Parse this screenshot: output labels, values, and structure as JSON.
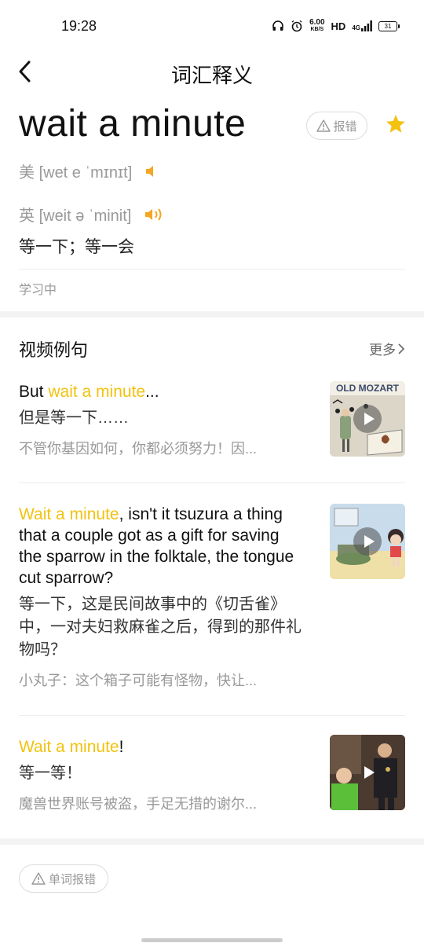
{
  "status_bar": {
    "time": "19:28",
    "net_speed_value": "6.00",
    "net_speed_unit": "KB/S",
    "hd": "HD",
    "signal": "4G",
    "battery": "31"
  },
  "header": {
    "title": "词汇释义"
  },
  "word": {
    "text": "wait a minute",
    "report_label": "报错",
    "us_label": "美",
    "us_phonetic": "[wet e ˈmɪnɪt]",
    "uk_label": "英",
    "uk_phonetic": "[weit ə ˈminit]",
    "meaning": "等一下；等一会",
    "status": "学习中"
  },
  "video_section": {
    "title": "视频例句",
    "more_label": "更多",
    "items": [
      {
        "en_pre": "But ",
        "en_hl": "wait a minute",
        "en_post": "...",
        "cn": "但是等一下……",
        "source": "不管你基因如何，你都必须努力！因...",
        "thumb_text": "OLD MOZART"
      },
      {
        "en_pre": "",
        "en_hl": "Wait a minute",
        "en_post": ", isn't it tsuzura a thing that a couple got as a gift for saving the sparrow in the folktale, the tongue cut sparrow?",
        "cn": "等一下，这是民间故事中的《切舌雀》中，一对夫妇救麻雀之后，得到的那件礼物吗？",
        "source": "小丸子：这个箱子可能有怪物，快让..."
      },
      {
        "en_pre": "",
        "en_hl": "Wait a minute",
        "en_post": "!",
        "cn": "等一等！",
        "source": "魔兽世界账号被盗，手足无措的谢尔..."
      }
    ]
  },
  "footer": {
    "word_report_label": "单词报错"
  },
  "colors": {
    "accent": "#f2c20f",
    "muted": "#999999"
  }
}
